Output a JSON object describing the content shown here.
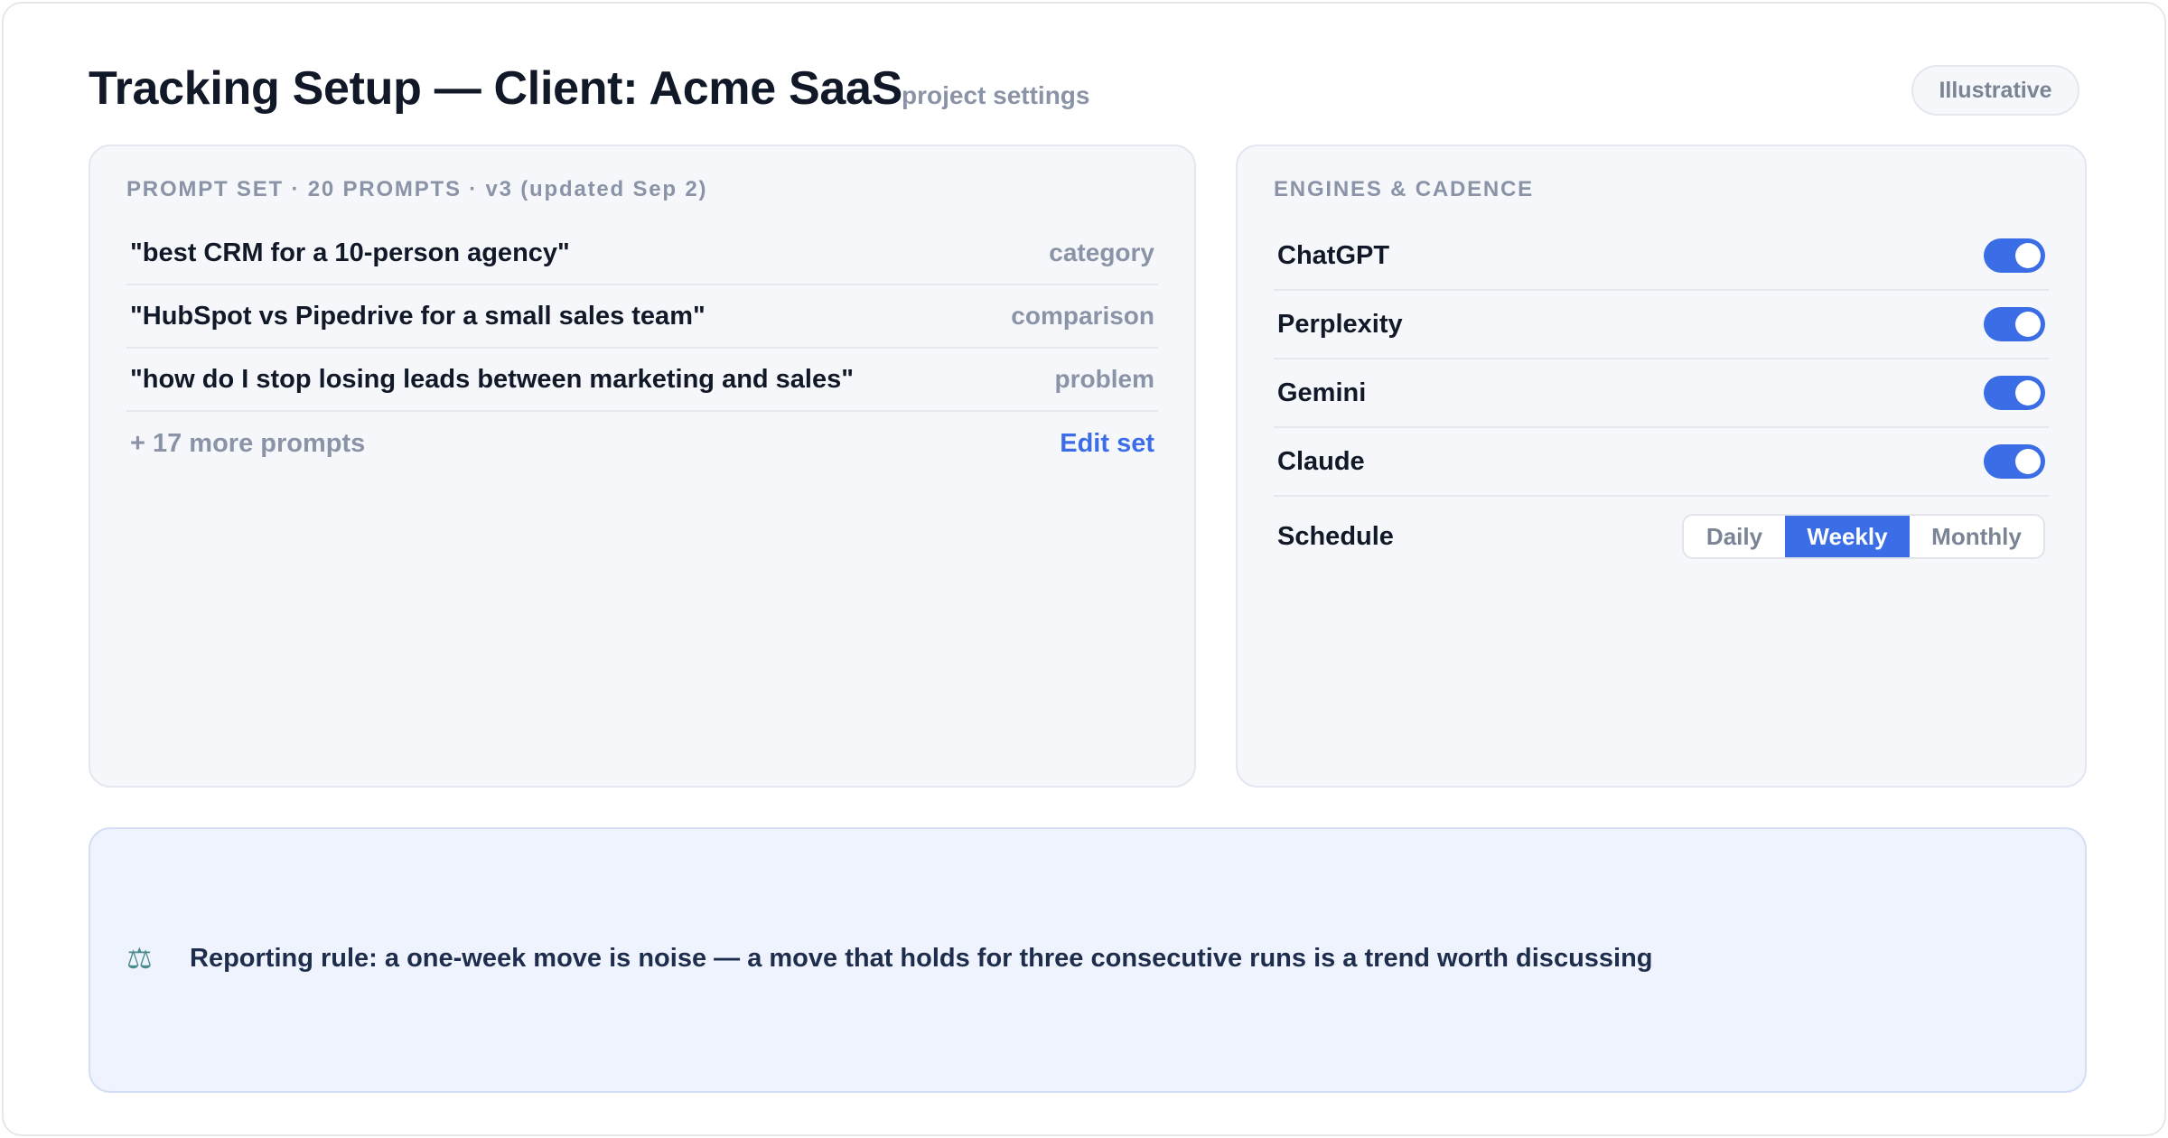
{
  "header": {
    "title": "Tracking Setup — Client: Acme SaaS",
    "subtitle": "project settings",
    "badge": "Illustrative"
  },
  "prompt_set": {
    "label": "PROMPT SET · 20 PROMPTS · v3 (updated Sep 2)",
    "prompts": [
      {
        "text": "\"best CRM for a 10-person agency\"",
        "tag": "category"
      },
      {
        "text": "\"HubSpot vs Pipedrive for a small sales team\"",
        "tag": "comparison"
      },
      {
        "text": "\"how do I stop losing leads between marketing and sales\"",
        "tag": "problem"
      }
    ],
    "more": "+ 17 more prompts",
    "edit_label": "Edit set"
  },
  "engines": {
    "label": "ENGINES & CADENCE",
    "items": [
      {
        "name": "ChatGPT",
        "enabled": true
      },
      {
        "name": "Perplexity",
        "enabled": true
      },
      {
        "name": "Gemini",
        "enabled": true
      },
      {
        "name": "Claude",
        "enabled": true
      }
    ],
    "schedule_label": "Schedule",
    "schedule_options": [
      "Daily",
      "Weekly",
      "Monthly"
    ],
    "schedule_selected": "Weekly",
    "accent_color": "#3b6ee6"
  },
  "note": {
    "icon": "balance-scale-icon",
    "text": "Reporting rule: a one-week move is noise — a move that holds for three consecutive runs is a trend worth discussing"
  }
}
